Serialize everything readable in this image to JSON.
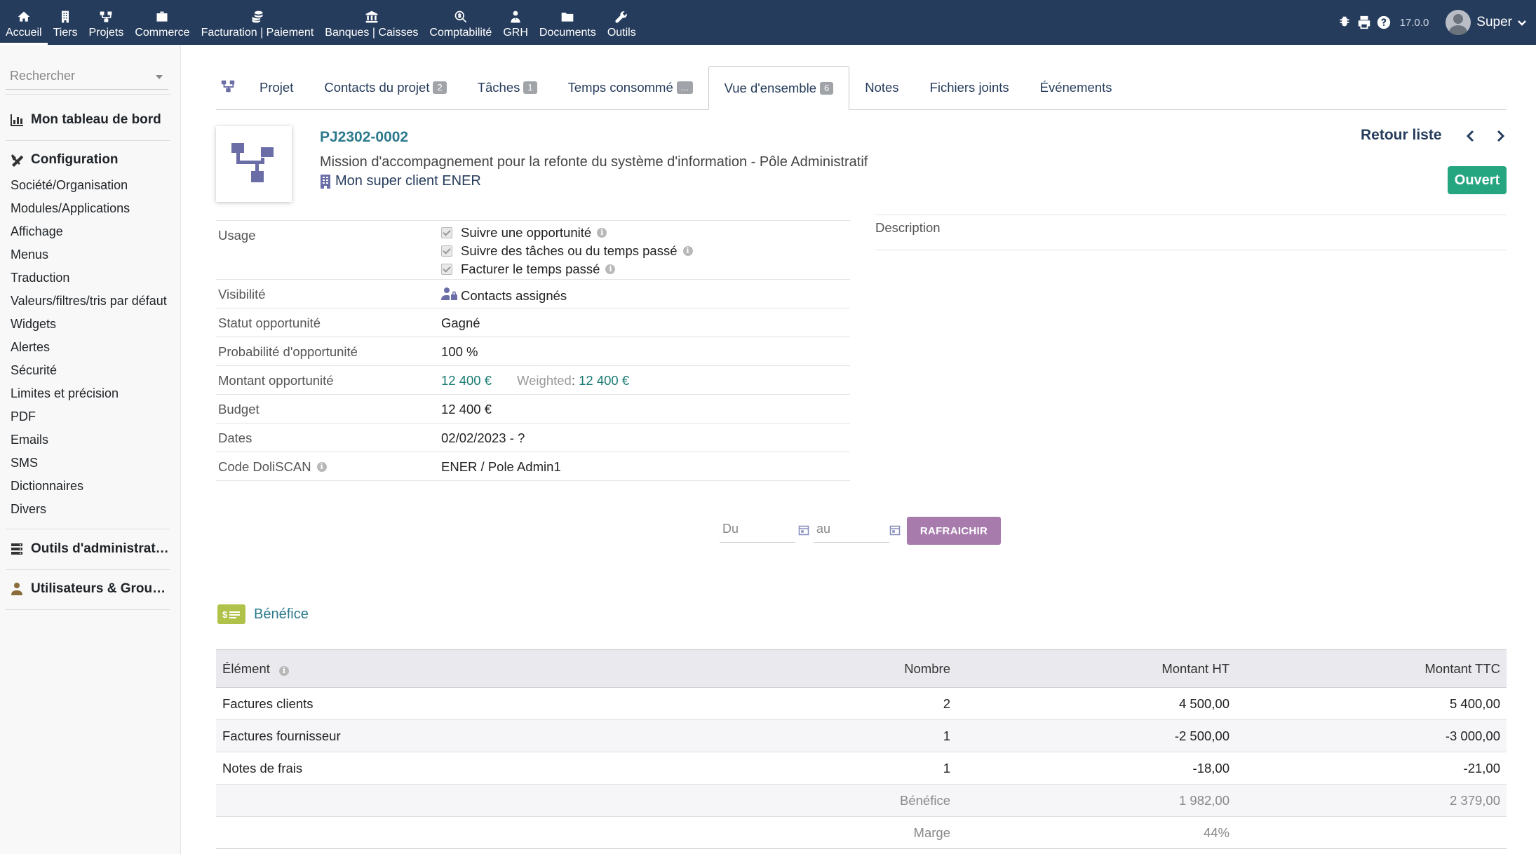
{
  "topmenu": [
    {
      "label": "Accueil",
      "icon": "home-icon"
    },
    {
      "label": "Tiers",
      "icon": "building-icon"
    },
    {
      "label": "Projets",
      "icon": "project-icon"
    },
    {
      "label": "Commerce",
      "icon": "briefcase-icon"
    },
    {
      "label": "Facturation | Paiement",
      "icon": "coins-icon"
    },
    {
      "label": "Banques | Caisses",
      "icon": "bank-icon"
    },
    {
      "label": "Comptabilité",
      "icon": "search-dollar-icon"
    },
    {
      "label": "GRH",
      "icon": "user-tie-icon"
    },
    {
      "label": "Documents",
      "icon": "folder-icon"
    },
    {
      "label": "Outils",
      "icon": "wrench-icon"
    }
  ],
  "topright": {
    "version": "17.0.0",
    "username": "Super"
  },
  "sidebar": {
    "search_placeholder": "Rechercher",
    "dashboard": "Mon tableau de bord",
    "configuration": "Configuration",
    "config_items": [
      "Société/Organisation",
      "Modules/Applications",
      "Affichage",
      "Menus",
      "Traduction",
      "Valeurs/filtres/tris par défaut",
      "Widgets",
      "Alertes",
      "Sécurité",
      "Limites et précision",
      "PDF",
      "Emails",
      "SMS",
      "Dictionnaires",
      "Divers"
    ],
    "admin_tools": "Outils d'administration",
    "users_groups": "Utilisateurs & Groupes"
  },
  "tabs": [
    {
      "label": "Projet",
      "badge": ""
    },
    {
      "label": "Contacts du projet",
      "badge": "2"
    },
    {
      "label": "Tâches",
      "badge": "1"
    },
    {
      "label": "Temps consommé",
      "badge": "..."
    },
    {
      "label": "Vue d'ensemble",
      "badge": "6"
    },
    {
      "label": "Notes",
      "badge": ""
    },
    {
      "label": "Fichiers joints",
      "badge": ""
    },
    {
      "label": "Événements",
      "badge": ""
    }
  ],
  "project": {
    "ref": "PJ2302-0002",
    "title": "Mission d'accompagnement pour la refonte du système d'information - Pôle Administratif",
    "client": "Mon super client ENER",
    "back_label": "Retour liste",
    "status": "Ouvert"
  },
  "fields": {
    "usage_label": "Usage",
    "usage_options": [
      "Suivre une opportunité",
      "Suivre des tâches ou du temps passé",
      "Facturer le temps passé"
    ],
    "visibility_label": "Visibilité",
    "visibility_value": "Contacts assignés",
    "opp_status_label": "Statut opportunité",
    "opp_status_value": "Gagné",
    "opp_prob_label": "Probabilité d'opportunité",
    "opp_prob_value": "100 %",
    "opp_amount_label": "Montant opportunité",
    "opp_amount_value": "12 400 €",
    "weighted_label": "Weighted",
    "weighted_value": "12 400 €",
    "budget_label": "Budget",
    "budget_value": "12 400 €",
    "dates_label": "Dates",
    "dates_value": "02/02/2023 - ?",
    "code_label": "Code DoliSCAN",
    "code_value": "ENER / Pole Admin1",
    "description_label": "Description"
  },
  "filter": {
    "from_placeholder": "Du",
    "to_placeholder": "au",
    "refresh_label": "RAFRAICHIR"
  },
  "benefit": {
    "title": "Bénéfice",
    "headers": [
      "Élément",
      "Nombre",
      "Montant HT",
      "Montant TTC"
    ],
    "rows": [
      {
        "element": "Factures clients",
        "count": "2",
        "ht": "4 500,00",
        "ttc": "5 400,00"
      },
      {
        "element": "Factures fournisseur",
        "count": "1",
        "ht": "-2 500,00",
        "ttc": "-3 000,00"
      },
      {
        "element": "Notes de frais",
        "count": "1",
        "ht": "-18,00",
        "ttc": "-21,00"
      }
    ],
    "total_label": "Bénéfice",
    "total_ht": "1 982,00",
    "total_ttc": "2 379,00",
    "margin_label": "Marge",
    "margin_value": "44%"
  },
  "colors": {
    "navbar": "#263c5c",
    "status_open": "#25a580",
    "refresh_button": "#a77cad",
    "amount": "#1a7b73"
  }
}
